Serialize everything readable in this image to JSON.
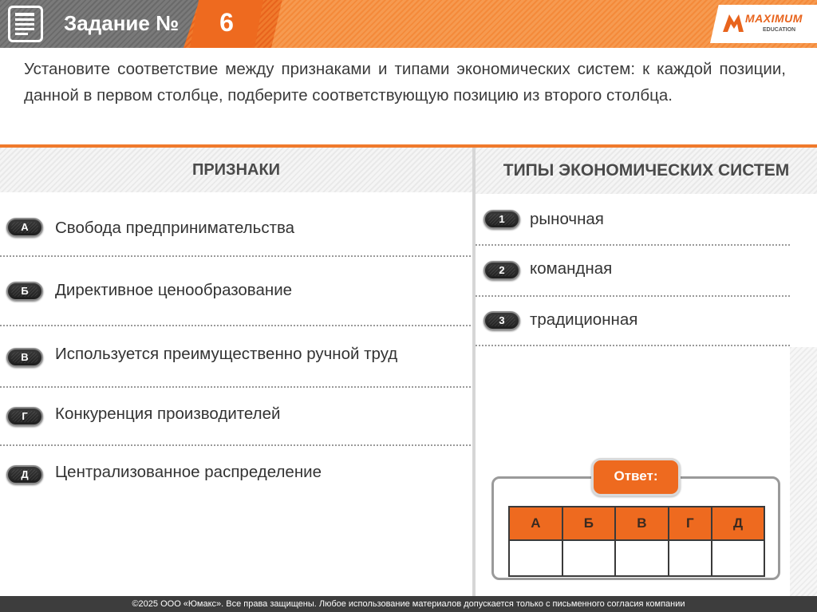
{
  "header": {
    "task_label": "Задание №",
    "task_number": "6",
    "logo_text": "MAXIMUM",
    "logo_subtext": "EDUCATION",
    "icon": "document-icon"
  },
  "instruction": "Установите соответствие между признаками и типами экономических систем: к каждой позиции, данной в первом столбце, подберите соответствующую позицию из второго столбца.",
  "columns": {
    "left_title": "ПРИЗНАКИ",
    "right_title": "ТИПЫ ЭКОНОМИЧЕСКИХ СИСТЕМ"
  },
  "features": [
    {
      "key": "А",
      "text": "Свобода предпринимательства"
    },
    {
      "key": "Б",
      "text": "Директивное ценообразование"
    },
    {
      "key": "В",
      "text": "Используется преимущественно ручной труд"
    },
    {
      "key": "Г",
      "text": "Конкуренция производителей"
    },
    {
      "key": "Д",
      "text": "Централизованное распределение"
    }
  ],
  "types": [
    {
      "key": "1",
      "text": "рыночная"
    },
    {
      "key": "2",
      "text": "командная"
    },
    {
      "key": "3",
      "text": "традиционная"
    }
  ],
  "answer": {
    "title": "Ответ:",
    "headers": [
      "А",
      "Б",
      "В",
      "Г",
      "Д"
    ],
    "values": [
      "",
      "",
      "",
      "",
      ""
    ]
  },
  "footer": "©2025 ООО «Юмакс». Все права защищены. Любое использование материалов допускается только с  письменного согласия компании",
  "colors": {
    "accent": "#ee6a1f",
    "header_dark": "#6a6a6a",
    "text": "#3b3b3b",
    "footer_bg": "#3d3d3d"
  }
}
